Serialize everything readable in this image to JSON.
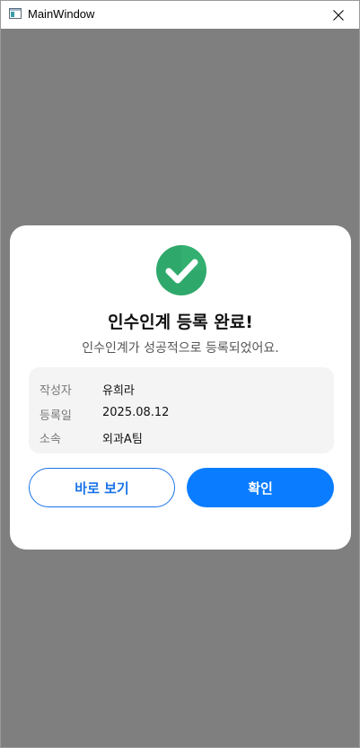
{
  "window": {
    "title": "MainWindow"
  },
  "dialog": {
    "icon": "check-circle-icon",
    "title": "인수인계 등록 완료!",
    "subtitle": "인수인계가 성공적으로 등록되었어요.",
    "info": [
      {
        "label": "작성자",
        "value": "유희라"
      },
      {
        "label": "등록일",
        "value": "2025.08.12"
      },
      {
        "label": "소속",
        "value": "외과A팀"
      }
    ],
    "buttons": {
      "view_label": "바로 보기",
      "confirm_label": "확인"
    }
  },
  "colors": {
    "overlay": "#7f7f7f",
    "success": "#2fa96b",
    "primary": "#0a7cff",
    "secondary_border": "#1a73e8"
  }
}
